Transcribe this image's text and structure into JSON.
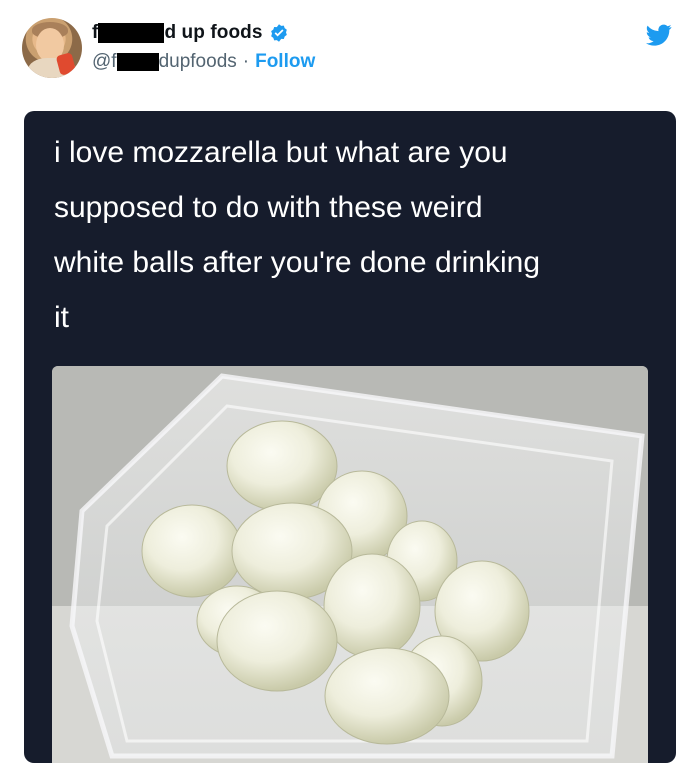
{
  "author": {
    "name_prefix": "f",
    "name_suffix": "d up foods",
    "handle_prefix": "@f",
    "handle_suffix": "dupfoods",
    "separator": "·",
    "follow_label": "Follow",
    "verified": true
  },
  "tweet": {
    "text": "i love mozzarella but what are you\nsupposed to do with these weird\nwhite balls after you're done drinking\nit"
  },
  "icons": {
    "brand": "twitter-bird-icon",
    "badge": "verified-badge-icon"
  },
  "colors": {
    "card_background": "#161c2c",
    "link": "#1d9bf0",
    "handle_text": "#536471",
    "name_text": "#0f1419",
    "tweet_text": "#ffffff"
  }
}
